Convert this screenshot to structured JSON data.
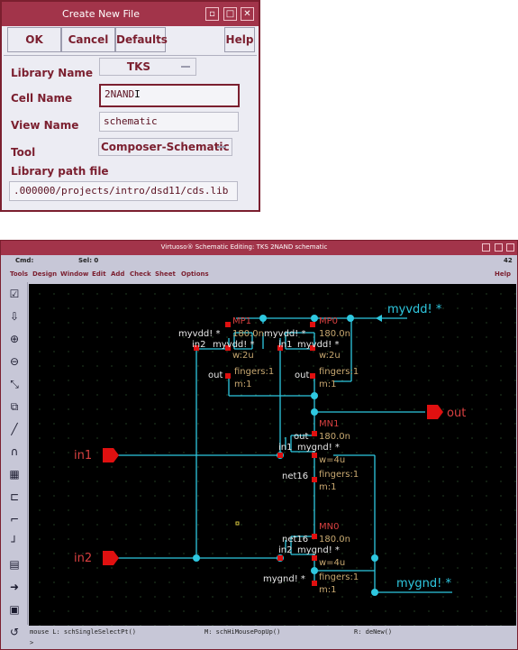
{
  "dialog": {
    "title": "Create New File",
    "buttons": {
      "ok": "OK",
      "cancel": "Cancel",
      "defaults": "Defaults",
      "help": "Help"
    },
    "library_name_label": "Library Name",
    "library_name_value": "TKS",
    "cell_name_label": "Cell Name",
    "cell_name_value": "2NAND",
    "view_name_label": "View Name",
    "view_name_value": "schematic",
    "tool_label": "Tool",
    "tool_value": "Composer-Schematic",
    "library_path_label": "Library path file",
    "library_path_value": ".000000/projects/intro/dsd11/cds.lib"
  },
  "virtuoso": {
    "title": "Virtuoso® Schematic Editing: TKS 2NAND schematic",
    "cmd_label": "Cmd:",
    "sel_label": "Sel: 0",
    "counter": "42",
    "menu": [
      "Tools",
      "Design",
      "Window",
      "Edit",
      "Add",
      "Check",
      "Sheet",
      "Options"
    ],
    "help": "Help",
    "toolbar_icons": [
      "check-save-icon",
      "save-icon",
      "zoom-in-icon",
      "zoom-out-icon",
      "stretch-icon",
      "copy-icon",
      "wire-icon",
      "wire-narrow-icon",
      "bus-icon",
      "instance-icon",
      "pin-icon",
      "wire-name-icon",
      "label-icon",
      "property-icon",
      "delete-icon",
      "undo-icon"
    ],
    "footer": {
      "mouse_l": "mouse L: schSingleSelectPt()",
      "mouse_m": "M: schHiMousePopUp()",
      "mouse_r": "R: deNew()",
      "prompt": ">"
    }
  },
  "schematic": {
    "pins": {
      "in1": "in1",
      "in2": "in2",
      "out": "out",
      "myvdd": "myvdd! *",
      "mygnd": "mygnd! *"
    },
    "mp1": {
      "name": "MP1",
      "len": "180.0n",
      "left_label": "myvdd! *",
      "gate": "in2",
      "body": "myvdd! *",
      "w": "w:2u",
      "drain": "out",
      "fingers": "fingers:1",
      "m": "m:1"
    },
    "mp0": {
      "name": "MP0",
      "len": "180.0n",
      "left_label": "myvdd! *",
      "gate": "in1",
      "body": "myvdd! *",
      "w": "w:2u",
      "drain": "out",
      "fingers": "fingers:1",
      "m": "m:1"
    },
    "mn1": {
      "name": "MN1",
      "top_label": "out",
      "len": "180.0n",
      "gate": "in1",
      "body": "mygnd! *",
      "w": "w=4u",
      "src": "net16",
      "fingers": "fingers:1",
      "m": "m:1"
    },
    "mn0": {
      "name": "MN0",
      "top_label": "net16",
      "len": "180.0n",
      "gate": "in2",
      "body": "mygnd! *",
      "w": "w=4u",
      "src": "mygnd! *",
      "fingers": "fingers:1",
      "m": "m:1"
    }
  },
  "colors": {
    "title_bar": "#a2344a",
    "wire": "#2ec8e0",
    "pin": "#e01010",
    "label": "#c8a870",
    "inst_name": "#d84040"
  }
}
